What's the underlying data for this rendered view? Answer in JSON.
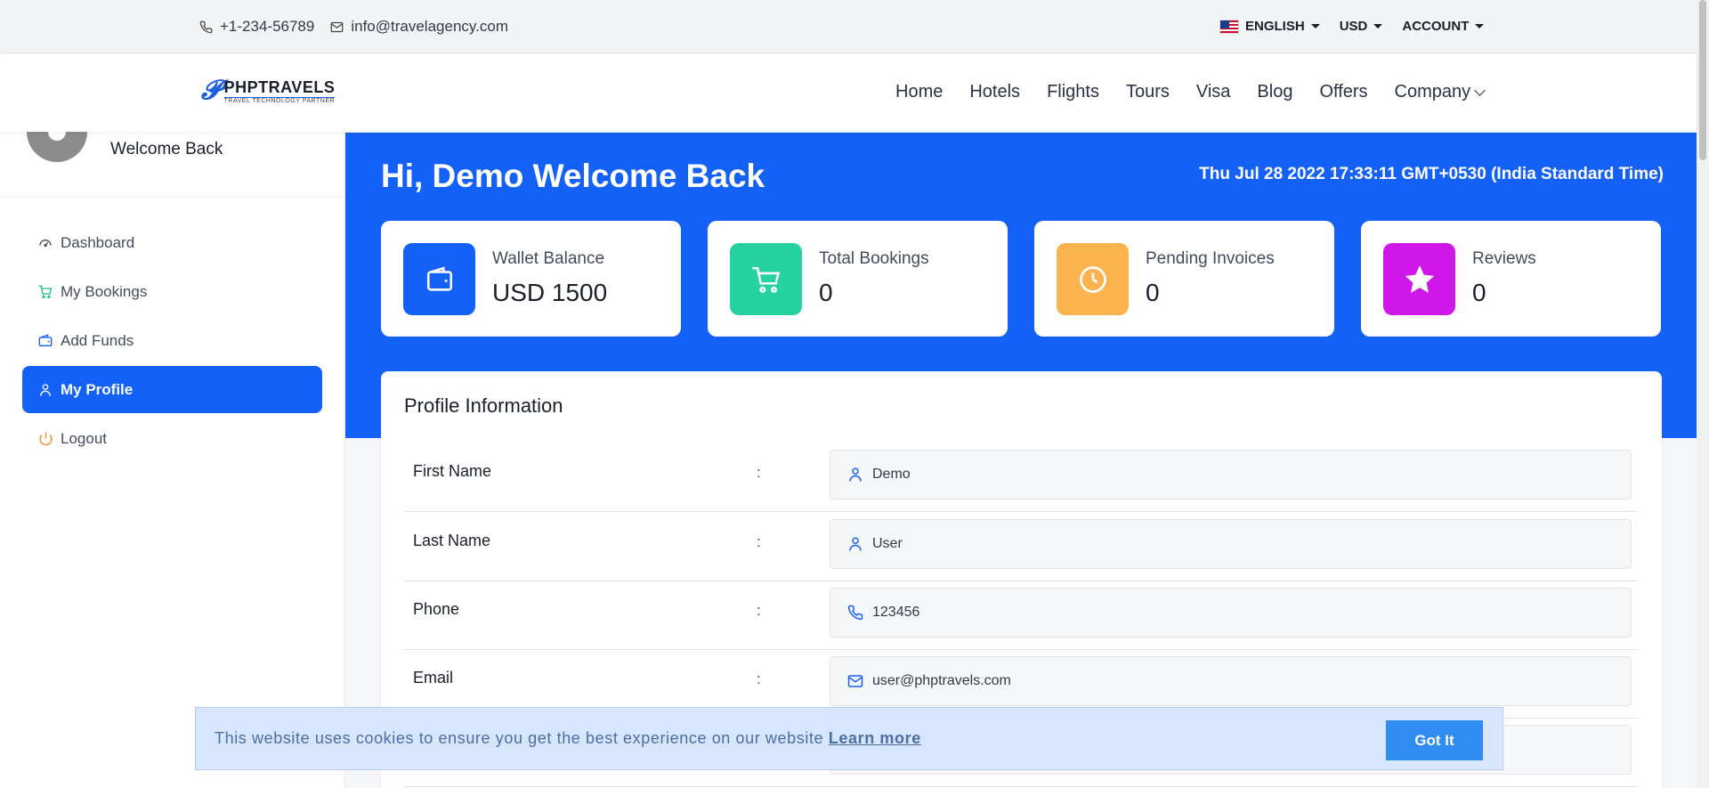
{
  "topbar": {
    "phone": "+1-234-56789",
    "email": "info@travelagency.com",
    "language": "ENGLISH",
    "currency": "USD",
    "account": "ACCOUNT"
  },
  "logo": {
    "name": "PHPTRAVELS",
    "tagline": "TRAVEL TECHNOLOGY PARTNER"
  },
  "nav": {
    "items": [
      "Home",
      "Hotels",
      "Flights",
      "Tours",
      "Visa",
      "Blog",
      "Offers",
      "Company"
    ]
  },
  "sidebar": {
    "welcome": "Welcome Back",
    "items": [
      {
        "label": "Dashboard",
        "icon": "dashboard-icon"
      },
      {
        "label": "My Bookings",
        "icon": "cart-icon"
      },
      {
        "label": "Add Funds",
        "icon": "wallet-icon"
      },
      {
        "label": "My Profile",
        "icon": "user-icon"
      },
      {
        "label": "Logout",
        "icon": "power-icon"
      }
    ]
  },
  "hero": {
    "title": "Hi, Demo Welcome Back",
    "date": "Thu Jul 28 2022 17:33:11 GMT+0530 (India Standard Time)"
  },
  "cards": [
    {
      "label": "Wallet Balance",
      "value": "USD 1500",
      "color": "#1461f7",
      "icon": "wallet-icon"
    },
    {
      "label": "Total Bookings",
      "value": "0",
      "color": "#26d3a0",
      "icon": "cart-icon"
    },
    {
      "label": "Pending Invoices",
      "value": "0",
      "color": "#fbb44d",
      "icon": "clock-icon"
    },
    {
      "label": "Reviews",
      "value": "0",
      "color": "#cf17e8",
      "icon": "star-icon"
    }
  ],
  "profile": {
    "title": "Profile Information",
    "rows": [
      {
        "label": "First Name",
        "value": "Demo",
        "icon": "user-icon"
      },
      {
        "label": "Last Name",
        "value": "User",
        "icon": "user-icon"
      },
      {
        "label": "Phone",
        "value": "123456",
        "icon": "phone-icon"
      },
      {
        "label": "Email",
        "value": "user@phptravels.com",
        "icon": "mail-icon"
      }
    ],
    "separator": ":"
  },
  "cookie": {
    "message": "This website uses cookies to ensure you get the best experience on our website",
    "link": "Learn more",
    "button": "Got It"
  },
  "colors": {
    "primary": "#1461f7",
    "cookie_bg": "#d8e6fd",
    "cookie_button": "#2f8cf1"
  }
}
